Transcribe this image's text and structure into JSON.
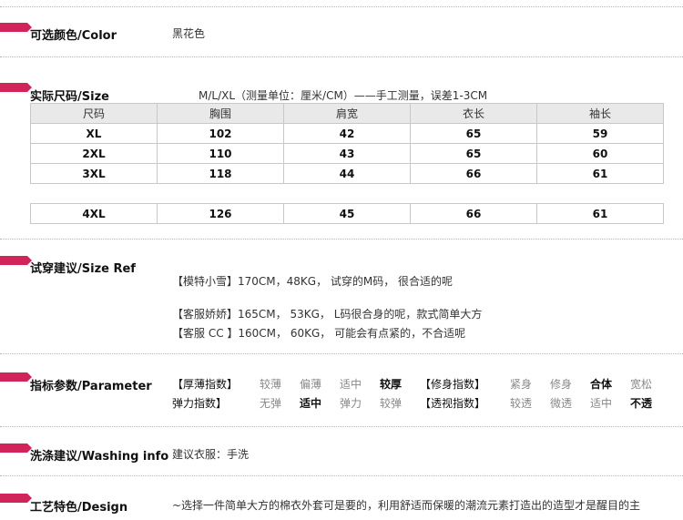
{
  "color_section": {
    "title": "可选颜色/Color",
    "value": "黑花色"
  },
  "size_section": {
    "title": "实际尺码/Size",
    "note": "M/L/XL（测量单位：厘米/CM）——手工测量，误差1-3CM",
    "headers": [
      "尺码",
      "胸围",
      "肩宽",
      "衣长",
      "袖长"
    ],
    "rows": [
      [
        "XL",
        "102",
        "42",
        "65",
        "59"
      ],
      [
        "2XL",
        "110",
        "43",
        "65",
        "60"
      ],
      [
        "3XL",
        "118",
        "44",
        "66",
        "61"
      ]
    ],
    "extra_row": [
      "4XL",
      "126",
      "45",
      "66",
      "61"
    ]
  },
  "size_ref": {
    "title": "试穿建议/Size Ref",
    "lines": [
      "【模特小雪】170CM，48KG， 试穿的M码， 很合适的呢",
      "【客服娇娇】165CM， 53KG， L码很合身的呢，款式简单大方",
      "【客服 CC 】160CM， 60KG， 可能会有点紧的，不合适呢"
    ]
  },
  "parameter": {
    "title": "指标参数/Parameter",
    "row1": {
      "thick_label": "【厚薄指数】",
      "thick_options": [
        "较薄",
        "偏薄",
        "适中",
        "较厚"
      ],
      "thick_selected": 3,
      "fit_label": "【修身指数】",
      "fit_options": [
        "紧身",
        "修身",
        "合体",
        "宽松"
      ],
      "fit_selected": 2
    },
    "row2": {
      "stretch_label": "弹力指数】",
      "stretch_options": [
        "无弹",
        "适中",
        "弹力",
        "较弹"
      ],
      "stretch_selected": 1,
      "see_label": "【透视指数】",
      "see_options": [
        "较透",
        "微透",
        "适中",
        "不透"
      ],
      "see_selected": 3
    }
  },
  "washing": {
    "title": "洗涤建议/Washing info",
    "value": "建议衣服：手洗"
  },
  "design": {
    "title": "工艺特色/Design",
    "text": "~选择一件简单大方的棉衣外套可是要的，利用舒适而保暖的潮流元素打造出的造型才是醒目的主"
  },
  "colors": {
    "accent": "#d1245a"
  }
}
